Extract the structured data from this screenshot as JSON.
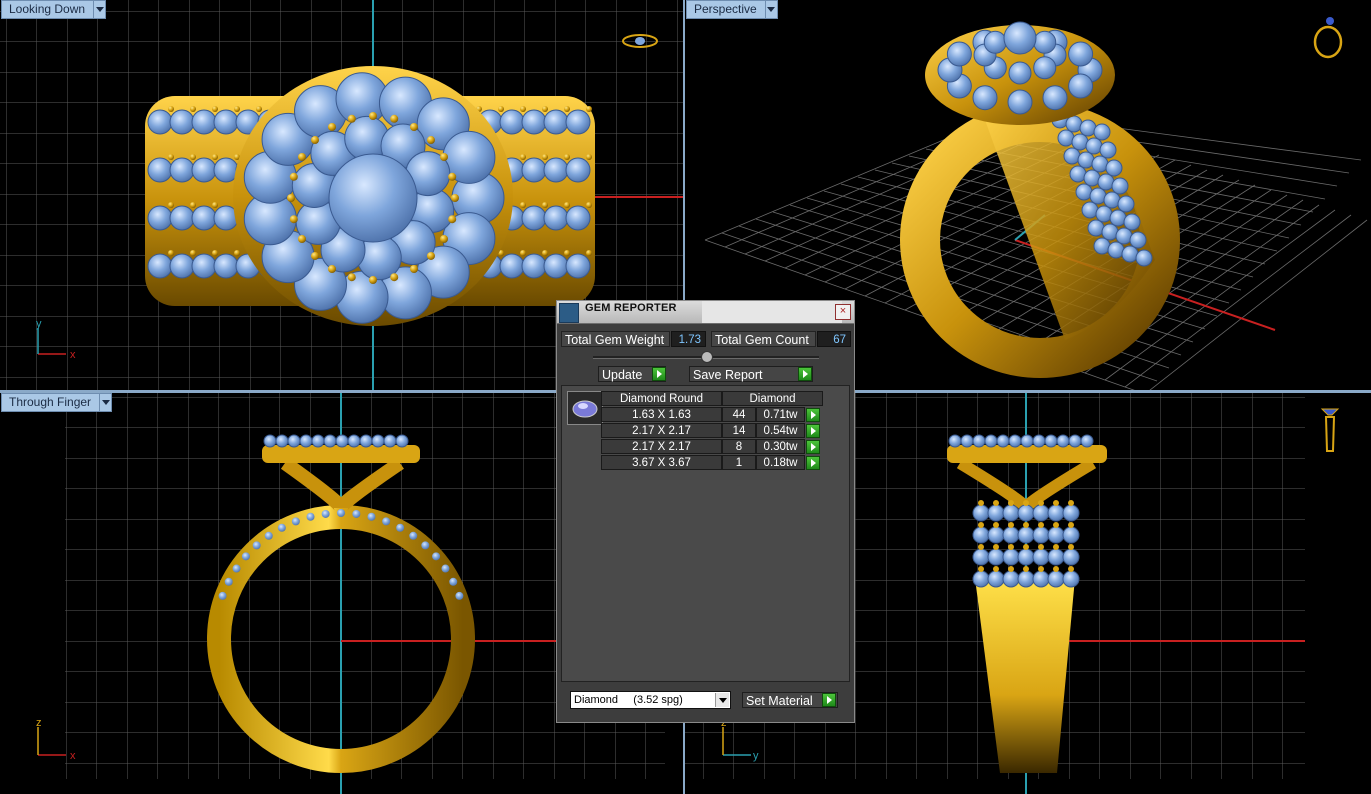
{
  "viewports": {
    "top_left": {
      "label": "Looking Down"
    },
    "top_right": {
      "label": "Perspective"
    },
    "bottom_left": {
      "label": "Through Finger"
    },
    "bottom_right": {
      "label": ""
    }
  },
  "axes": {
    "top_left": {
      "h": "x",
      "v": "y"
    },
    "bottom_left": {
      "h": "x",
      "v": "z"
    },
    "bottom_right": {
      "h": "y",
      "v": "z"
    }
  },
  "gem_reporter": {
    "title": "GEM REPORTER",
    "total_weight_label": "Total Gem Weight",
    "total_weight_value": "1.73",
    "total_count_label": "Total Gem Count",
    "total_count_value": "67",
    "update_label": "Update",
    "save_report_label": "Save Report",
    "table": {
      "col_shape": "Diamond Round",
      "col_material": "Diamond",
      "rows": [
        {
          "size": "1.63 X 1.63",
          "count": "44",
          "weight": "0.71tw"
        },
        {
          "size": "2.17 X 2.17",
          "count": "14",
          "weight": "0.54tw"
        },
        {
          "size": "2.17 X 2.17",
          "count": "8",
          "weight": "0.30tw"
        },
        {
          "size": "3.67 X 3.67",
          "count": "1",
          "weight": "0.18tw"
        }
      ]
    },
    "material_select": "Diamond     (3.52 spg)",
    "set_material_label": "Set Material"
  },
  "colors": {
    "grid": "#5a5a5a",
    "gold": "#d9a514",
    "gem": "#7fa6dc",
    "axis_red": "#c82020",
    "axis_cyan": "#2aa0b0"
  }
}
